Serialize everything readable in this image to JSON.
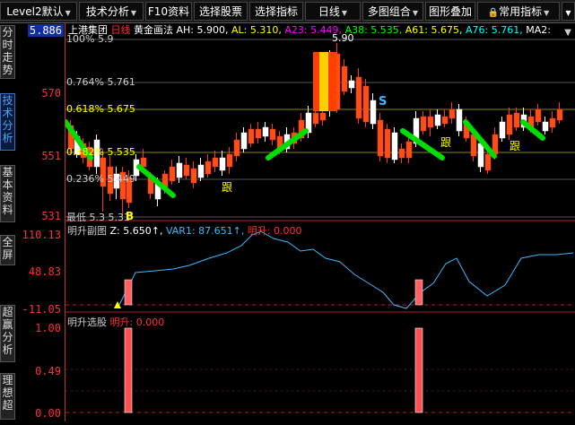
{
  "toolbar": {
    "level2": "Level2默认",
    "tech": "技术分析",
    "f10": "F10资料",
    "select_stock": "选择股票",
    "select_indicator": "选择指标",
    "period": "日线",
    "multi": "多图组合",
    "overlay": "图形叠加",
    "common": "常用指标"
  },
  "sidebar": {
    "tabs": [
      "分时走势",
      "技术分析",
      "基本资料",
      "全屏",
      "超赢分析",
      "理想超"
    ]
  },
  "main_panel": {
    "stock_name": "上港集团",
    "period": "日线",
    "indicator": "黄金画法",
    "params": [
      {
        "label": "AH: 5.900,",
        "color": "#ffffff"
      },
      {
        "label": "AL: 5.310,",
        "color": "#ffff00"
      },
      {
        "label": "A23: 5.449,",
        "color": "#ff00ff"
      },
      {
        "label": "A38: 5.535,",
        "color": "#00ff00"
      },
      {
        "label": "A61: 5.675,",
        "color": "#ffff00"
      },
      {
        "label": "A76: 5.761,",
        "color": "#00ffff"
      },
      {
        "label": "MA2:",
        "color": "#ffffff"
      }
    ],
    "current_price": "5.886",
    "y_ticks": [
      "570",
      "551",
      "531"
    ],
    "levels": [
      {
        "label": "100%  5.9",
        "color": "#cccccc"
      },
      {
        "label": "0.764%  5.761",
        "color": "#cccccc"
      },
      {
        "label": "0.618%  5.675",
        "color": "#ffff00"
      },
      {
        "label": "0.382%  5.535",
        "color": "#ffff00"
      },
      {
        "label": "0.236%  5.449",
        "color": "#cccccc"
      },
      {
        "label": "最低  5.3  5.31",
        "color": "#cccccc"
      }
    ],
    "peak_label": "5.90",
    "gen_label": "跟",
    "s_label": "S",
    "b_label": "B"
  },
  "sub1": {
    "title": "明升副图",
    "z": "Z: 5.650↑,",
    "var1": "VAR1: 87.651↑,",
    "ms": "明升: 0.000",
    "y_ticks": [
      "110.13",
      "48.83",
      "-11.05"
    ]
  },
  "sub2": {
    "title": "明升选股",
    "ms": "明升: 0.000",
    "y_ticks": [
      "1.00",
      "0.49",
      "0.00"
    ]
  },
  "colors": {
    "up": "#ff3030",
    "down": "#ffffff",
    "grid": "#b02020",
    "line": "#3fb8ff"
  }
}
